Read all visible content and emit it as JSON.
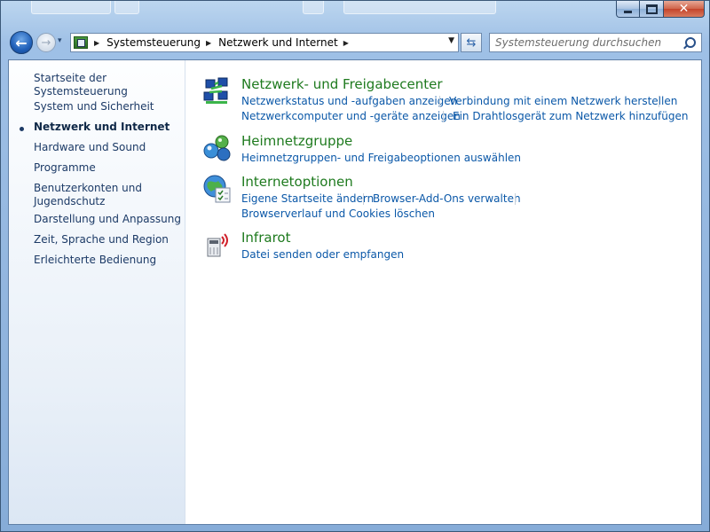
{
  "window": {
    "controls": {
      "minimize": "",
      "maximize": "",
      "close": "✕"
    }
  },
  "navigation": {
    "back_glyph": "←",
    "forward_glyph": "→",
    "recent_glyph": "▾",
    "breadcrumb": [
      "Systemsteuerung",
      "Netzwerk und Internet"
    ],
    "search_placeholder": "Systemsteuerung durchsuchen"
  },
  "sidebar": {
    "home": "Startseite der Systemsteuerung",
    "items": [
      "System und Sicherheit",
      "Netzwerk und Internet",
      "Hardware und Sound",
      "Programme",
      "Benutzerkonten und Jugendschutz",
      "Darstellung und Anpassung",
      "Zeit, Sprache und Region",
      "Erleichterte Bedienung"
    ],
    "active_item": "Netzwerk und Internet"
  },
  "categories": [
    {
      "title": "Netzwerk- und Freigabecenter",
      "icon": "network-sharing-icon",
      "links": [
        "Netzwerkstatus und -aufgaben anzeigen",
        "Verbindung mit einem Netzwerk herstellen",
        "Netzwerkcomputer und -geräte anzeigen",
        "Ein Drahtlosgerät zum Netzwerk hinzufügen"
      ]
    },
    {
      "title": "Heimnetzgruppe",
      "icon": "homegroup-icon",
      "links": [
        "Heimnetzgruppen- und Freigabeoptionen auswählen"
      ]
    },
    {
      "title": "Internetoptionen",
      "icon": "internet-options-icon",
      "links": [
        "Eigene Startseite ändern",
        "Browser-Add-Ons verwalten",
        "Browserverlauf und Cookies löschen"
      ]
    },
    {
      "title": "Infrarot",
      "icon": "infrared-icon",
      "links": [
        "Datei senden oder empfangen"
      ]
    }
  ],
  "colors": {
    "category_title": "#1e7a1e",
    "link": "#0b58a8",
    "sidebar_text": "#1c3a66"
  }
}
